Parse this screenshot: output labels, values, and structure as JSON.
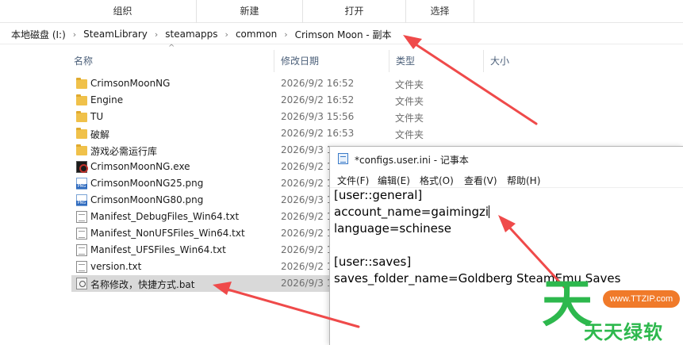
{
  "ribbon": {
    "groups": [
      "组织",
      "新建",
      "打开",
      "选择"
    ]
  },
  "address_bar": {
    "crumbs": [
      "本地磁盘 (I:)",
      "SteamLibrary",
      "steamapps",
      "common",
      "Crimson Moon - 副本"
    ]
  },
  "columns": {
    "name": "名称",
    "date": "修改日期",
    "type": "类型",
    "size": "大小"
  },
  "files": [
    {
      "name": "CrimsonMoonNG",
      "date": "2026/9/2 16:52",
      "type": "文件夹",
      "icon": "folder-icon"
    },
    {
      "name": "Engine",
      "date": "2026/9/2 16:52",
      "type": "文件夹",
      "icon": "folder-icon"
    },
    {
      "name": "TU",
      "date": "2026/9/3 15:56",
      "type": "文件夹",
      "icon": "folder-icon"
    },
    {
      "name": "破解",
      "date": "2026/9/2 16:53",
      "type": "文件夹",
      "icon": "folder-icon"
    },
    {
      "name": "游戏必需运行库",
      "date": "2026/9/3 1",
      "type": "",
      "icon": "folder-icon"
    },
    {
      "name": "CrimsonMoonNG.exe",
      "date": "2026/9/2 1",
      "type": "",
      "icon": "exe-icon"
    },
    {
      "name": "CrimsonMoonNG25.png",
      "date": "2026/9/2 1",
      "type": "",
      "icon": "png-icon"
    },
    {
      "name": "CrimsonMoonNG80.png",
      "date": "2026/9/3 1",
      "type": "",
      "icon": "png-icon"
    },
    {
      "name": "Manifest_DebugFiles_Win64.txt",
      "date": "2026/9/2 1",
      "type": "",
      "icon": "txt-icon"
    },
    {
      "name": "Manifest_NonUFSFiles_Win64.txt",
      "date": "2026/9/2 1",
      "type": "",
      "icon": "txt-icon"
    },
    {
      "name": "Manifest_UFSFiles_Win64.txt",
      "date": "2026/9/2 1",
      "type": "",
      "icon": "txt-icon"
    },
    {
      "name": "version.txt",
      "date": "2026/9/2 1",
      "type": "",
      "icon": "txt-icon"
    },
    {
      "name": "名称修改，快捷方式.bat",
      "date": "2026/9/3 1",
      "type": "",
      "icon": "bat-icon"
    }
  ],
  "notepad": {
    "title": "*configs.user.ini - 记事本",
    "menu": [
      "文件(F)",
      "编辑(E)",
      "格式(O)",
      "查看(V)",
      "帮助(H)"
    ],
    "lines": [
      "[user::general]",
      "account_name=gaimingzi",
      "language=schinese",
      "",
      "[user::saves]",
      "saves_folder_name=Goldberg SteamEmu Saves"
    ]
  },
  "watermark": {
    "char": "天",
    "url": "www.TTZIP.com",
    "brand": "天天绿软"
  },
  "colors": {
    "arrow": "#ef4a4a",
    "selection": "#d9d9d9",
    "watermark_green": "#2db84d",
    "watermark_orange": "#f07a2a"
  }
}
